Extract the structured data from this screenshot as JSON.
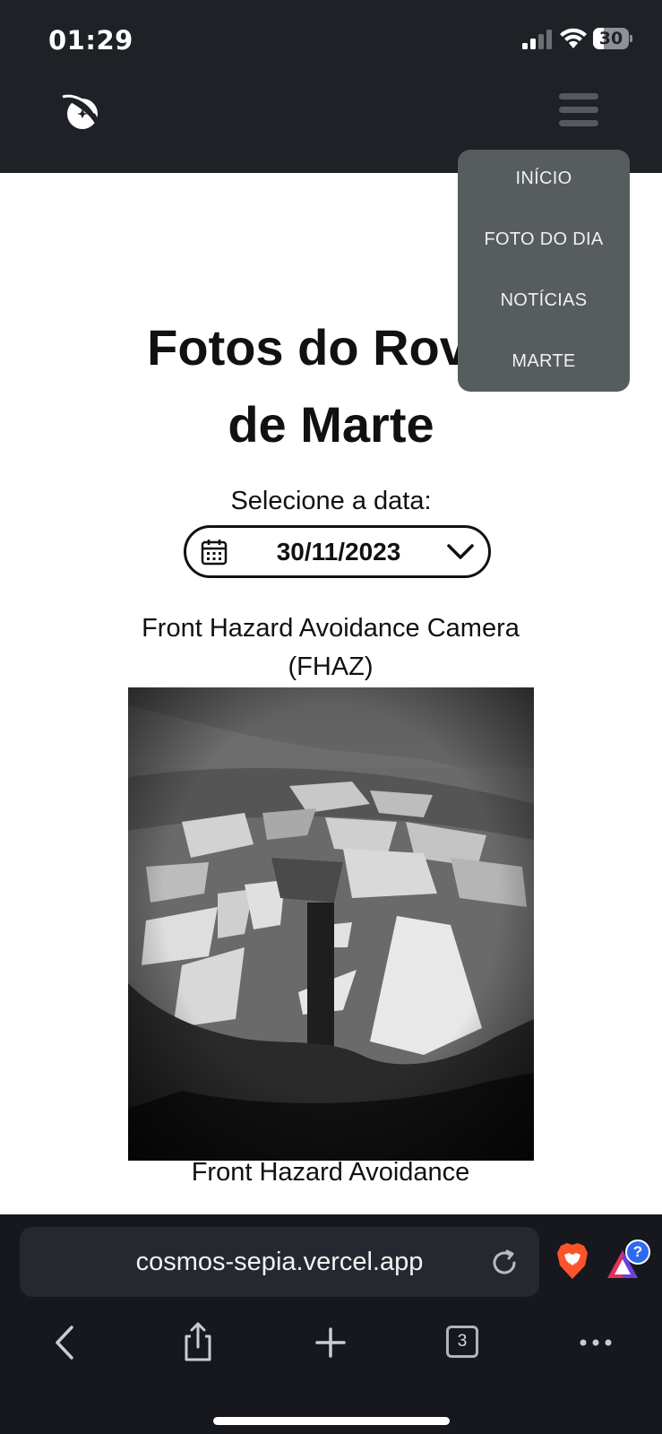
{
  "status_bar": {
    "time": "01:29",
    "battery_percent": "30",
    "battery_level": 0.3
  },
  "nav_menu": {
    "items": [
      {
        "label": "INÍCIO"
      },
      {
        "label": "FOTO DO DIA"
      },
      {
        "label": "NOTÍCIAS"
      },
      {
        "label": "MARTE"
      }
    ]
  },
  "main": {
    "title_line1": "Fotos do Rover",
    "title_line2": "de Marte",
    "date_label": "Selecione a data:",
    "date_value": "30/11/2023",
    "photos": [
      {
        "camera": "Front Hazard Avoidance Camera (FHAZ)"
      },
      {
        "camera": "Front Hazard Avoidance"
      }
    ]
  },
  "browser": {
    "url": "cosmos-sepia.vercel.app",
    "tab_count": "3",
    "rewards_badge": "?"
  },
  "colors": {
    "header_bg": "#1e2226",
    "menu_bg": "#575c5f",
    "text": "#111111",
    "browser_bg": "#16181d",
    "brave_orange": "#fb542b"
  }
}
